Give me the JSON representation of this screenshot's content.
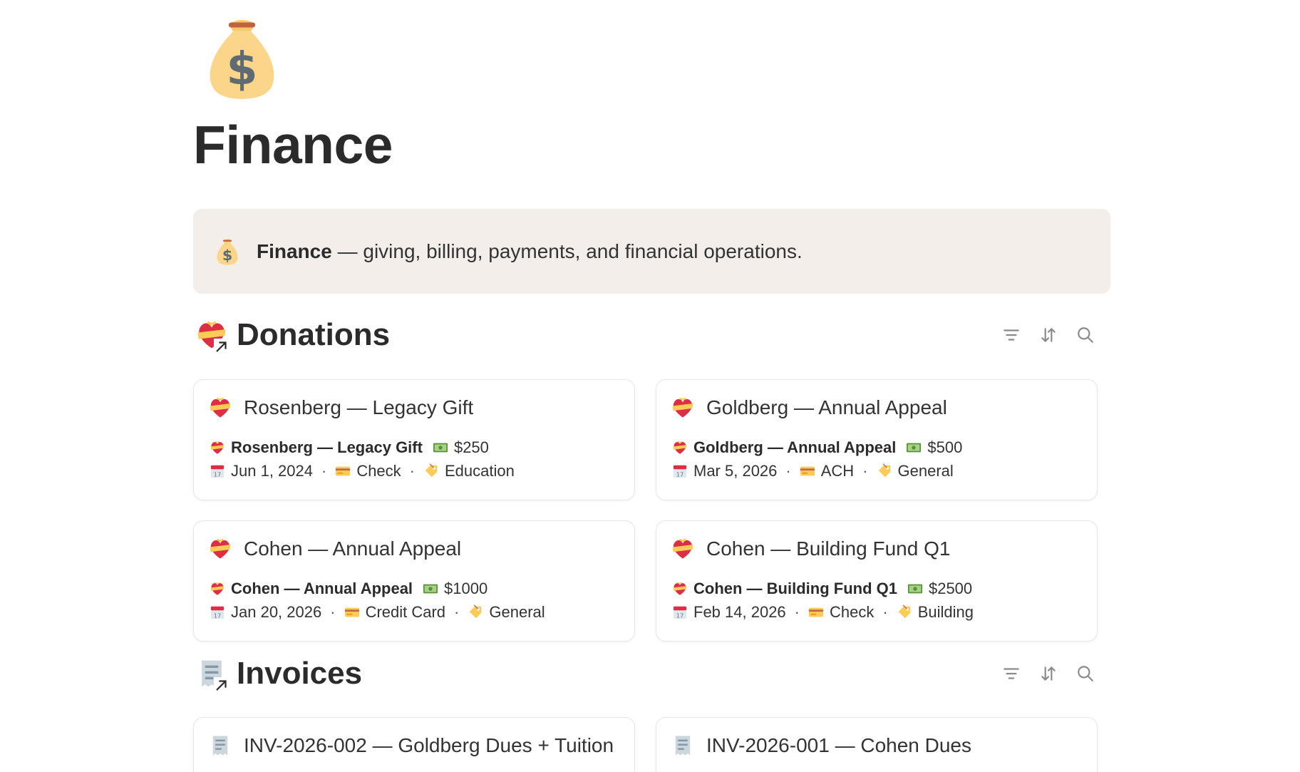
{
  "page": {
    "title": "Finance",
    "icon": "money-bag-icon"
  },
  "callout": {
    "icon": "money-bag-icon",
    "bold": "Finance",
    "text": " — giving, billing, payments, and financial operations."
  },
  "donations": {
    "title": "Donations",
    "icon": "heart-with-ribbon-icon",
    "tools": [
      "filter-icon",
      "sort-icon",
      "search-icon"
    ],
    "cards": [
      {
        "title": "Rosenberg — Legacy Gift",
        "name": "Rosenberg — Legacy Gift",
        "amount": "$250",
        "date": "Jun 1, 2024",
        "method": "Check",
        "fund": "Education"
      },
      {
        "title": "Goldberg — Annual Appeal",
        "name": "Goldberg — Annual Appeal",
        "amount": "$500",
        "date": "Mar 5, 2026",
        "method": "ACH",
        "fund": "General"
      },
      {
        "title": "Cohen — Annual Appeal",
        "name": "Cohen — Annual Appeal",
        "amount": "$1000",
        "date": "Jan 20, 2026",
        "method": "Credit Card",
        "fund": "General"
      },
      {
        "title": "Cohen — Building Fund Q1",
        "name": "Cohen — Building Fund Q1",
        "amount": "$2500",
        "date": "Feb 14, 2026",
        "method": "Check",
        "fund": "Building"
      }
    ]
  },
  "invoices": {
    "title": "Invoices",
    "icon": "receipt-icon",
    "tools": [
      "filter-icon",
      "sort-icon",
      "search-icon"
    ],
    "cards": [
      {
        "title": "INV-2026-002 — Goldberg Dues + Tuition"
      },
      {
        "title": "INV-2026-001 — Cohen Dues"
      }
    ]
  },
  "colors": {
    "callout_bg": "#f4eeeb",
    "text": "#2f2f2f",
    "card_border": "#e6e6e6"
  }
}
